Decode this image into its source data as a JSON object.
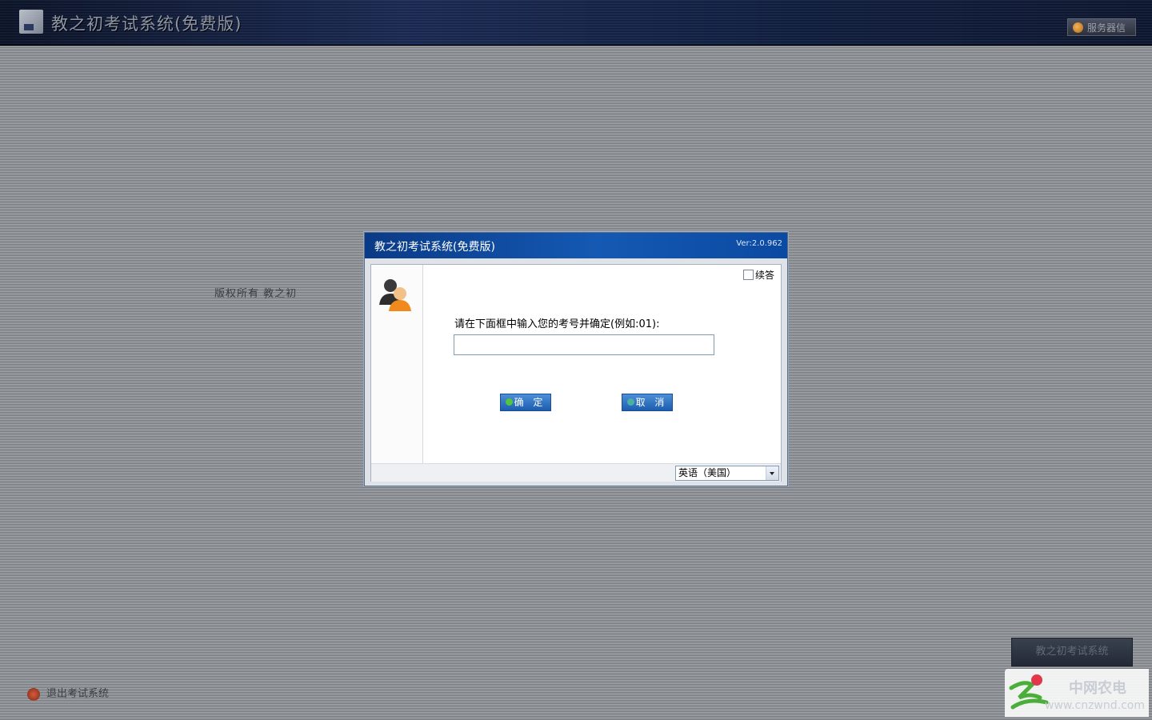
{
  "header": {
    "title": "教之初考试系统(免费版)",
    "service_label": "服务器信",
    "logo_icon": "app-logo-icon"
  },
  "background": {
    "center_label": "版权所有 教之初",
    "bottom_left_label": "退出考试系统",
    "bottom_right_label": "教之初考试系统"
  },
  "watermark": {
    "name": "中网农电",
    "url": "www.cnzwnd.com"
  },
  "dialog": {
    "title": "教之初考试系统(免费版)",
    "version": "Ver:2.0.962",
    "continue_label": "续答",
    "continue_checked": false,
    "prompt": "请在下面框中输入您的考号并确定(例如:01):",
    "input_value": "",
    "ok_label": "确 定",
    "cancel_label": "取 消",
    "language": "英语（美国）"
  },
  "colors": {
    "titlebar": "#1459b3",
    "button": "#1c5db0",
    "header_bg": "#0b1a3c"
  }
}
